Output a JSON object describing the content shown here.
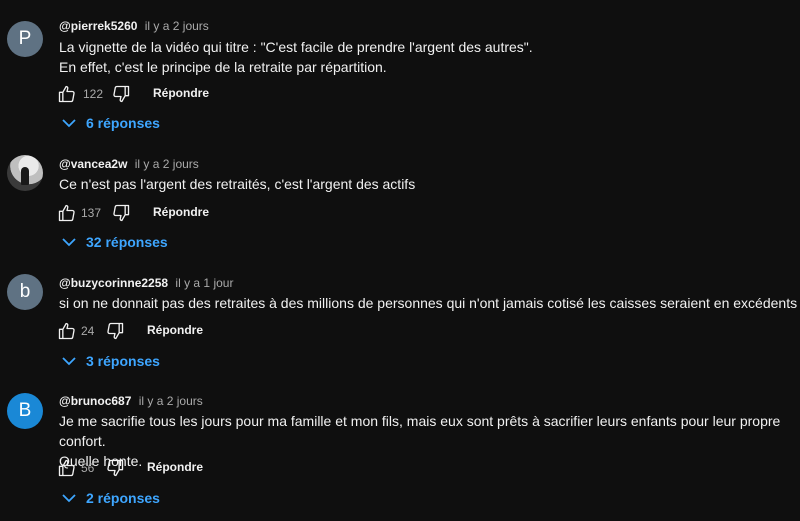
{
  "colors": {
    "background": "#0f0f0f",
    "text": "#f1f1f1",
    "muted": "#aaaaaa",
    "link": "#3ea6ff",
    "avatar_p": "#5f7283",
    "avatar_b_gray": "#5f7283",
    "avatar_b_blue": "#1a88d6"
  },
  "icons": {
    "like": "thumb-up-icon",
    "dislike": "thumb-down-icon",
    "expand": "chevron-down-icon"
  },
  "comments": [
    {
      "avatar_letter": "P",
      "author": "@pierrek5260",
      "time": "il y a 2 jours",
      "lines": [
        "La vignette de la vidéo qui titre : \"C'est facile de prendre l'argent des autres\".",
        "En effet, c'est le principe de la retraite par répartition."
      ],
      "likes": "122",
      "reply_label": "Répondre",
      "replies_label": "6 réponses"
    },
    {
      "avatar_letter": "",
      "author": "@vancea2w",
      "time": "il y a 2 jours",
      "lines": [
        "Ce n'est pas l'argent des retraités, c'est l'argent des actifs"
      ],
      "likes": "137",
      "reply_label": "Répondre",
      "replies_label": "32 réponses"
    },
    {
      "avatar_letter": "b",
      "author": "@buzycorinne2258",
      "time": "il y a 1 jour",
      "lines": [
        "si on ne donnait pas des retraites à des millions de personnes qui n'ont jamais cotisé les caisses seraient en excédents"
      ],
      "likes": "24",
      "reply_label": "Répondre",
      "replies_label": "3 réponses"
    },
    {
      "avatar_letter": "B",
      "author": "@brunoc687",
      "time": "il y a 2 jours",
      "lines": [
        "Je me sacrifie tous les jours pour ma famille et mon fils, mais eux sont prêts à sacrifier leurs enfants pour leur propre confort.",
        "Quelle honte."
      ],
      "likes": "56",
      "reply_label": "Répondre",
      "replies_label": "2 réponses"
    }
  ]
}
